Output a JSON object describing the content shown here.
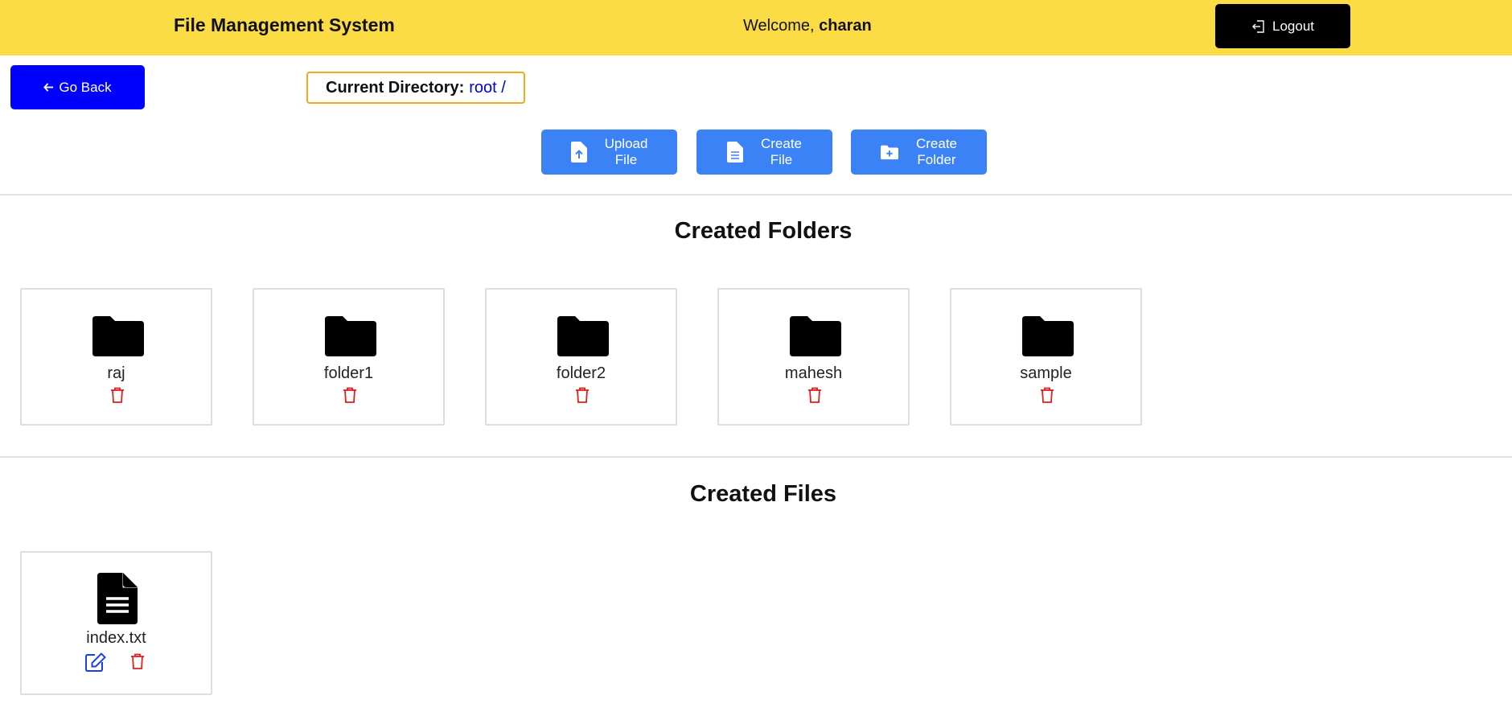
{
  "header": {
    "title": "File Management System",
    "welcome_prefix": "Welcome,",
    "username": "charan",
    "logout_label": "Logout"
  },
  "toolbar": {
    "back_label": "Go Back",
    "current_dir_label": "Current Directory:",
    "current_dir_value": "root /",
    "upload_line1": "Upload",
    "upload_line2": "File",
    "create_file_line1": "Create",
    "create_file_line2": "File",
    "create_folder_line1": "Create",
    "create_folder_line2": "Folder"
  },
  "folders_section": {
    "title": "Created Folders",
    "items": [
      {
        "name": "raj"
      },
      {
        "name": "folder1"
      },
      {
        "name": "folder2"
      },
      {
        "name": "mahesh"
      },
      {
        "name": "sample"
      }
    ]
  },
  "files_section": {
    "title": "Created Files",
    "items": [
      {
        "name": "index.txt"
      }
    ]
  },
  "colors": {
    "navbar": "#fbdc44",
    "primary": "#3b82f6",
    "back": "#0000ff",
    "danger": "#e11d1d",
    "edit": "#1d3fe0"
  },
  "icons": {
    "logout": "logout-icon",
    "back": "arrow-left-icon",
    "upload": "file-upload-icon",
    "create_file": "file-lines-icon",
    "create_folder": "folder-plus-icon",
    "folder": "folder-icon",
    "file": "file-text-icon",
    "delete": "trash-icon",
    "edit": "edit-icon"
  }
}
